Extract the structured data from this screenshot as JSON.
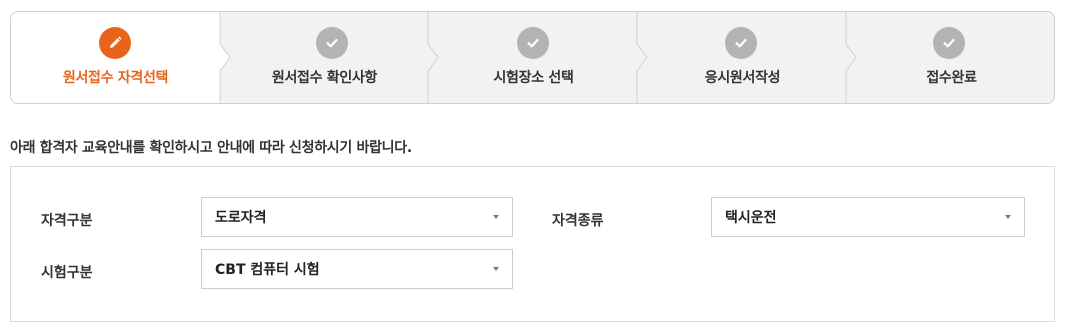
{
  "steps": [
    {
      "label": "원서접수 자격선택",
      "state": "active",
      "icon": "pencil-icon"
    },
    {
      "label": "원서접수 확인사항",
      "state": "done",
      "icon": "check-icon"
    },
    {
      "label": "시험장소 선택",
      "state": "done",
      "icon": "check-icon"
    },
    {
      "label": "응시원서작성",
      "state": "done",
      "icon": "check-icon"
    },
    {
      "label": "접수완료",
      "state": "done",
      "icon": "check-icon"
    }
  ],
  "guide_text": "아래 합격자 교육안내를 확인하시고 안내에 따라 신청하시기 바랍니다.",
  "form": {
    "qual_category": {
      "label": "자격구분",
      "value": "도로자격"
    },
    "qual_type": {
      "label": "자격종류",
      "value": "택시운전"
    },
    "exam_category": {
      "label": "시험구분",
      "value": "CBT 컴퓨터 시험"
    }
  },
  "colors": {
    "accent": "#e8641b",
    "done": "#b3b3b3",
    "step_bg": "#f2f2f2"
  }
}
